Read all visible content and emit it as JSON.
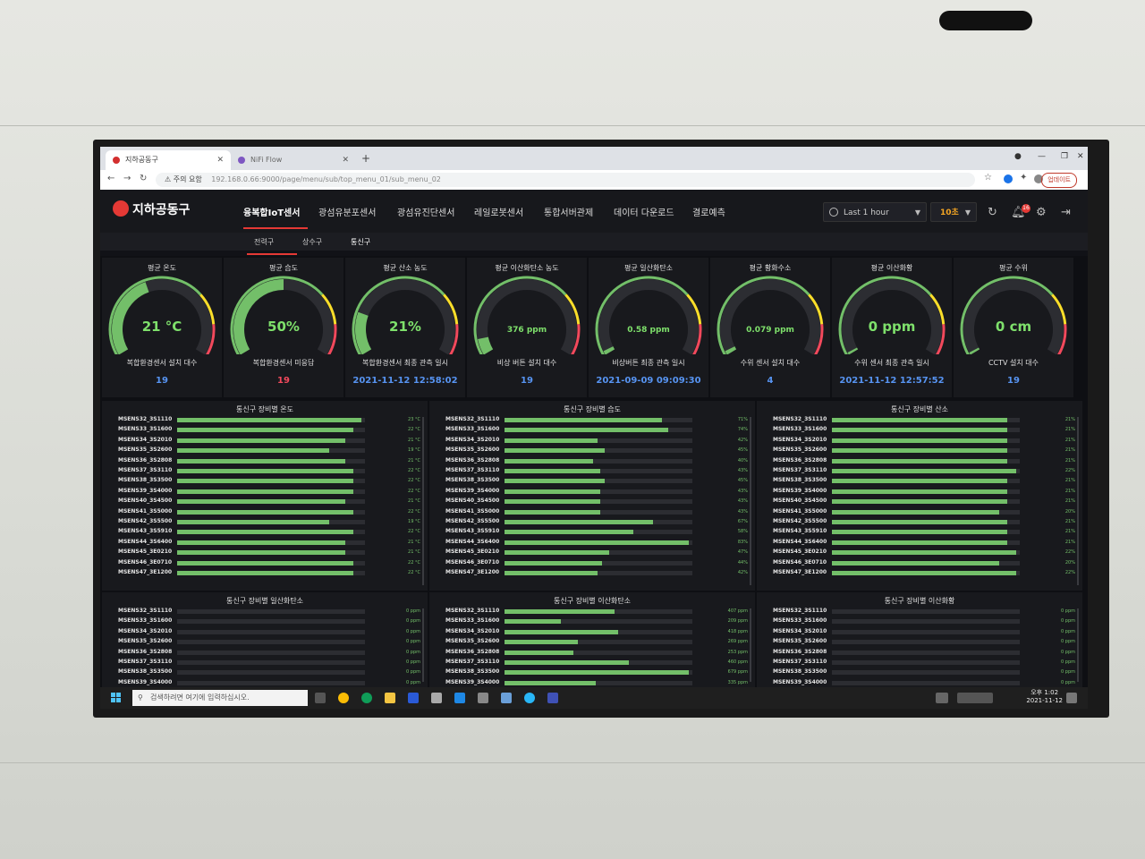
{
  "browser": {
    "tabs": [
      {
        "title": "지하공동구",
        "active": true
      },
      {
        "title": "NiFi Flow",
        "active": false
      }
    ],
    "url_warning": "주의 요함",
    "url": "192.168.0.66:9000/page/menu/sub/top_menu_01/sub_menu_02",
    "update_label": "업데이트"
  },
  "app": {
    "logo": "지하공동구",
    "menu": [
      "융복합IoT센서",
      "광섬유분포센서",
      "광섬유진단센서",
      "레일로봇센서",
      "통합서버관제",
      "데이터 다운로드",
      "결로예측"
    ],
    "active_menu": "융복합IoT센서",
    "time_range": "Last 1 hour",
    "refresh_interval": "10초",
    "notification_count": "16",
    "subtabs": [
      "전력구",
      "상수구",
      "통신구"
    ],
    "active_subtab": "통신구"
  },
  "gauges": [
    {
      "title": "평균 온도",
      "value": "21 °C",
      "fraction": 0.42,
      "stat_label": "복합환경센서 설치 대수",
      "stat_value": "19",
      "stat_color": "#5794f2"
    },
    {
      "title": "평균 습도",
      "value": "50%",
      "fraction": 0.5,
      "stat_label": "복합환경센서 미응답",
      "stat_value": "19",
      "stat_color": "#f2495c"
    },
    {
      "title": "평균 산소 농도",
      "value": "21%",
      "fraction": 0.21,
      "stat_label": "복합환경센서 최종 관측 일시",
      "stat_value": "2021-11-12 12:58:02",
      "stat_color": "#5794f2"
    },
    {
      "title": "평균 이산화탄소 농도",
      "value": "376 ppm",
      "fraction": 0.08,
      "stat_label": "비상 버튼 설치 대수",
      "stat_value": "19",
      "stat_color": "#5794f2"
    },
    {
      "title": "평균 일산화탄소",
      "value": "0.58 ppm",
      "fraction": 0.02,
      "stat_label": "비상버튼 최종 관측 일시",
      "stat_value": "2021-09-09 09:09:30",
      "stat_color": "#5794f2"
    },
    {
      "title": "평균 황화수소",
      "value": "0.079 ppm",
      "fraction": 0.02,
      "stat_label": "수위 센서 설치 대수",
      "stat_value": "4",
      "stat_color": "#5794f2"
    },
    {
      "title": "평균 이산화황",
      "value": "0 ppm",
      "fraction": 0.0,
      "stat_label": "수위 센서 최종 관측 일시",
      "stat_value": "2021-11-12 12:57:52",
      "stat_color": "#5794f2"
    },
    {
      "title": "평균 수위",
      "value": "0 cm",
      "fraction": 0.0,
      "stat_label": "CCTV 설치 대수",
      "stat_value": "19",
      "stat_color": "#5794f2"
    }
  ],
  "panels": [
    {
      "title": "통신구 장비별 온도",
      "rows": [
        {
          "label": "MSENS32_3S1110",
          "value": 23,
          "text": "23 °C"
        },
        {
          "label": "MSENS33_3S1600",
          "value": 22,
          "text": "22 °C"
        },
        {
          "label": "MSENS34_3S2010",
          "value": 21,
          "text": "21 °C"
        },
        {
          "label": "MSENS35_3S2600",
          "value": 19,
          "text": "19 °C"
        },
        {
          "label": "MSENS36_3S2808",
          "value": 21,
          "text": "21 °C"
        },
        {
          "label": "MSENS37_3S3110",
          "value": 22,
          "text": "22 °C"
        },
        {
          "label": "MSENS38_3S3500",
          "value": 22,
          "text": "22 °C"
        },
        {
          "label": "MSENS39_3S4000",
          "value": 22,
          "text": "22 °C"
        },
        {
          "label": "MSENS40_3S4500",
          "value": 21,
          "text": "21 °C"
        },
        {
          "label": "MSENS41_3S5000",
          "value": 22,
          "text": "22 °C"
        },
        {
          "label": "MSENS42_3S5500",
          "value": 19,
          "text": "19 °C"
        },
        {
          "label": "MSENS43_3S5910",
          "value": 22,
          "text": "22 °C"
        },
        {
          "label": "MSENS44_3S6400",
          "value": 21,
          "text": "21 °C"
        },
        {
          "label": "MSENS45_3E0210",
          "value": 21,
          "text": "21 °C"
        },
        {
          "label": "MSENS46_3E0710",
          "value": 22,
          "text": "22 °C"
        },
        {
          "label": "MSENS47_3E1200",
          "value": 22,
          "text": "22 °C"
        }
      ]
    },
    {
      "title": "통신구 장비별 습도",
      "rows": [
        {
          "label": "MSENS32_3S1110",
          "value": 71,
          "text": "71%"
        },
        {
          "label": "MSENS33_3S1600",
          "value": 74,
          "text": "74%"
        },
        {
          "label": "MSENS34_3S2010",
          "value": 42,
          "text": "42%"
        },
        {
          "label": "MSENS35_3S2600",
          "value": 45,
          "text": "45%"
        },
        {
          "label": "MSENS36_3S2808",
          "value": 40,
          "text": "40%"
        },
        {
          "label": "MSENS37_3S3110",
          "value": 43,
          "text": "43%"
        },
        {
          "label": "MSENS38_3S3500",
          "value": 45,
          "text": "45%"
        },
        {
          "label": "MSENS39_3S4000",
          "value": 43,
          "text": "43%"
        },
        {
          "label": "MSENS40_3S4500",
          "value": 43,
          "text": "43%"
        },
        {
          "label": "MSENS41_3S5000",
          "value": 43,
          "text": "43%"
        },
        {
          "label": "MSENS42_3S5500",
          "value": 67,
          "text": "67%"
        },
        {
          "label": "MSENS43_3S5910",
          "value": 58,
          "text": "58%"
        },
        {
          "label": "MSENS44_3S6400",
          "value": 83,
          "text": "83%"
        },
        {
          "label": "MSENS45_3E0210",
          "value": 47,
          "text": "47%"
        },
        {
          "label": "MSENS46_3E0710",
          "value": 44,
          "text": "44%"
        },
        {
          "label": "MSENS47_3E1200",
          "value": 42,
          "text": "42%"
        }
      ]
    },
    {
      "title": "통신구 장비별 산소",
      "rows": [
        {
          "label": "MSENS32_3S1110",
          "value": 21,
          "text": "21%"
        },
        {
          "label": "MSENS33_3S1600",
          "value": 21,
          "text": "21%"
        },
        {
          "label": "MSENS34_3S2010",
          "value": 21,
          "text": "21%"
        },
        {
          "label": "MSENS35_3S2600",
          "value": 21,
          "text": "21%"
        },
        {
          "label": "MSENS36_3S2808",
          "value": 21,
          "text": "21%"
        },
        {
          "label": "MSENS37_3S3110",
          "value": 22,
          "text": "22%"
        },
        {
          "label": "MSENS38_3S3500",
          "value": 21,
          "text": "21%"
        },
        {
          "label": "MSENS39_3S4000",
          "value": 21,
          "text": "21%"
        },
        {
          "label": "MSENS40_3S4500",
          "value": 21,
          "text": "21%"
        },
        {
          "label": "MSENS41_3S5000",
          "value": 20,
          "text": "20%"
        },
        {
          "label": "MSENS42_3S5500",
          "value": 21,
          "text": "21%"
        },
        {
          "label": "MSENS43_3S5910",
          "value": 21,
          "text": "21%"
        },
        {
          "label": "MSENS44_3S6400",
          "value": 21,
          "text": "21%"
        },
        {
          "label": "MSENS45_3E0210",
          "value": 22,
          "text": "22%"
        },
        {
          "label": "MSENS46_3E0710",
          "value": 20,
          "text": "20%"
        },
        {
          "label": "MSENS47_3E1200",
          "value": 22,
          "text": "22%"
        }
      ]
    },
    {
      "title": "통신구 장비별 일산화탄소",
      "rows": [
        {
          "label": "MSENS32_3S1110",
          "value": 0,
          "text": "0 ppm"
        },
        {
          "label": "MSENS33_3S1600",
          "value": 0,
          "text": "0 ppm"
        },
        {
          "label": "MSENS34_3S2010",
          "value": 0,
          "text": "0 ppm"
        },
        {
          "label": "MSENS35_3S2600",
          "value": 0,
          "text": "0 ppm"
        },
        {
          "label": "MSENS36_3S2808",
          "value": 0,
          "text": "0 ppm"
        },
        {
          "label": "MSENS37_3S3110",
          "value": 0,
          "text": "0 ppm"
        },
        {
          "label": "MSENS38_3S3500",
          "value": 0,
          "text": "0 ppm"
        },
        {
          "label": "MSENS39_3S4000",
          "value": 0,
          "text": "0 ppm"
        }
      ]
    },
    {
      "title": "통신구 장비별 이산화탄소",
      "rows": [
        {
          "label": "MSENS32_3S1110",
          "value": 407,
          "text": "407 ppm"
        },
        {
          "label": "MSENS33_3S1600",
          "value": 209,
          "text": "209 ppm"
        },
        {
          "label": "MSENS34_3S2010",
          "value": 418,
          "text": "418 ppm"
        },
        {
          "label": "MSENS35_3S2600",
          "value": 269,
          "text": "269 ppm"
        },
        {
          "label": "MSENS36_3S2808",
          "value": 253,
          "text": "253 ppm"
        },
        {
          "label": "MSENS37_3S3110",
          "value": 460,
          "text": "460 ppm"
        },
        {
          "label": "MSENS38_3S3500",
          "value": 679,
          "text": "679 ppm"
        },
        {
          "label": "MSENS39_3S4000",
          "value": 335,
          "text": "335 ppm"
        }
      ]
    },
    {
      "title": "통신구 장비별 이산화황",
      "rows": [
        {
          "label": "MSENS32_3S1110",
          "value": 0,
          "text": "0 ppm"
        },
        {
          "label": "MSENS33_3S1600",
          "value": 0,
          "text": "0 ppm"
        },
        {
          "label": "MSENS34_3S2010",
          "value": 0,
          "text": "0 ppm"
        },
        {
          "label": "MSENS35_3S2600",
          "value": 0,
          "text": "0 ppm"
        },
        {
          "label": "MSENS36_3S2808",
          "value": 0,
          "text": "0 ppm"
        },
        {
          "label": "MSENS37_3S3110",
          "value": 0,
          "text": "0 ppm"
        },
        {
          "label": "MSENS38_3S3500",
          "value": 0,
          "text": "0 ppm"
        },
        {
          "label": "MSENS39_3S4000",
          "value": 0,
          "text": "0 ppm"
        }
      ]
    }
  ],
  "taskbar": {
    "search_placeholder": "검색하려면 여기에 입력하십시오.",
    "time": "오후 1:02",
    "date": "2021-11-12"
  },
  "colors": {
    "green": "#73bf69",
    "yellow": "#fade2a",
    "red": "#f2495c",
    "accent": "#e53935"
  }
}
